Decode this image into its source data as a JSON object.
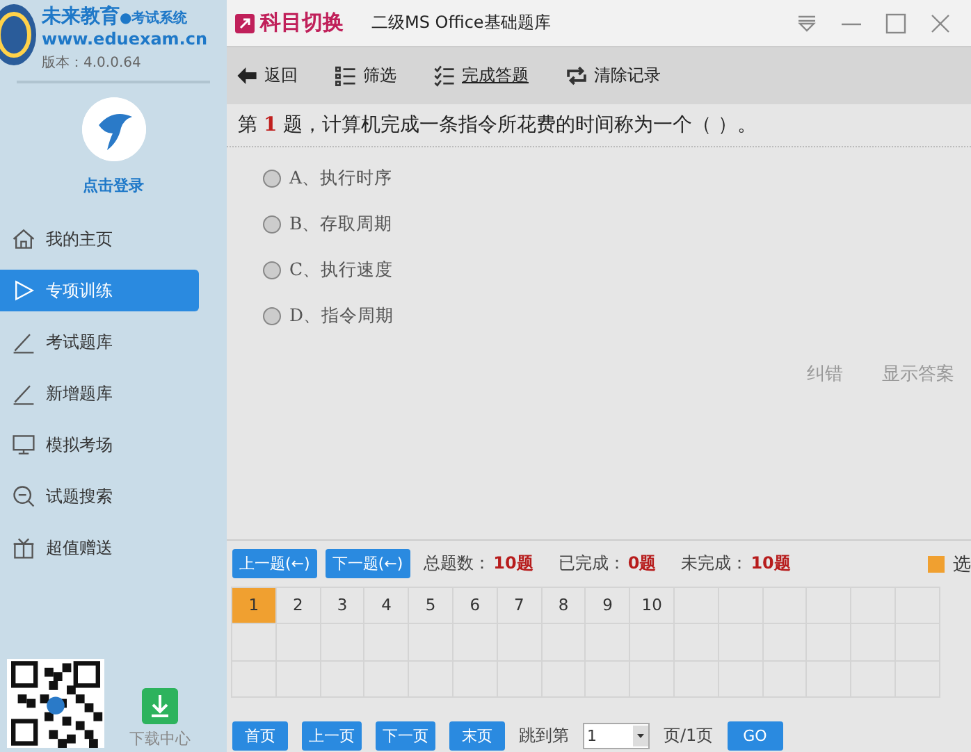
{
  "brand": {
    "name": "未来教育",
    "subtitle": "●考试系统",
    "url": "www.eduexam.cn",
    "version": "版本：4.0.0.64"
  },
  "user": {
    "login": "点击登录"
  },
  "sidebar": {
    "items": [
      {
        "label": "我的主页",
        "kind": "home",
        "selected": false
      },
      {
        "label": "专项训练",
        "kind": "play",
        "selected": true
      },
      {
        "label": "考试题库",
        "kind": "pen",
        "selected": false
      },
      {
        "label": "新增题库",
        "kind": "pen",
        "selected": false
      },
      {
        "label": "模拟考场",
        "kind": "monitor",
        "selected": false
      },
      {
        "label": "试题搜索",
        "kind": "search",
        "selected": false
      },
      {
        "label": "超值赠送",
        "kind": "gift",
        "selected": false
      }
    ],
    "download": "下载中心"
  },
  "titlebar": {
    "switch": "科目切换",
    "title": "二级MS Office基础题库"
  },
  "toolbar": [
    {
      "label": "返回",
      "kind": "back",
      "underline": false
    },
    {
      "label": "筛选",
      "kind": "filter",
      "underline": false
    },
    {
      "label": "完成答题",
      "kind": "checklist",
      "underline": true
    },
    {
      "label": "清除记录",
      "kind": "refresh",
      "underline": false
    }
  ],
  "question": {
    "text": "第 **1** 题，计算机完成一条指令所花费的时间称为一个（ ）。",
    "options": [
      {
        "label": "A、执行时序",
        "selected": false
      },
      {
        "label": "B、存取周期",
        "selected": false
      },
      {
        "label": "C、执行速度",
        "selected": false
      },
      {
        "label": "D、指令周期",
        "selected": false
      }
    ],
    "actions": [
      "纠错",
      "显示答案"
    ]
  },
  "nav": {
    "prev": "上一题(←)",
    "next": "下一题(←)",
    "stats": [
      {
        "label": "总题数：",
        "value": "10题"
      },
      {
        "label": "已完成：",
        "value": "0题"
      },
      {
        "label": "未完成：",
        "value": "10题"
      }
    ],
    "legend": "选",
    "cells": [
      {
        "label": "1",
        "selected": true
      },
      {
        "label": "2",
        "selected": false
      },
      {
        "label": "3",
        "selected": false
      },
      {
        "label": "4",
        "selected": false
      },
      {
        "label": "5",
        "selected": false
      },
      {
        "label": "6",
        "selected": false
      },
      {
        "label": "7",
        "selected": false
      },
      {
        "label": "8",
        "selected": false
      },
      {
        "label": "9",
        "selected": false
      },
      {
        "label": "10",
        "selected": false
      }
    ]
  },
  "pager": {
    "buttons": [
      "首页",
      "上一页",
      "下一页",
      "末页"
    ],
    "jump_label": "跳到第",
    "page_value": "1",
    "page_total": "页/1页",
    "go": "GO"
  }
}
